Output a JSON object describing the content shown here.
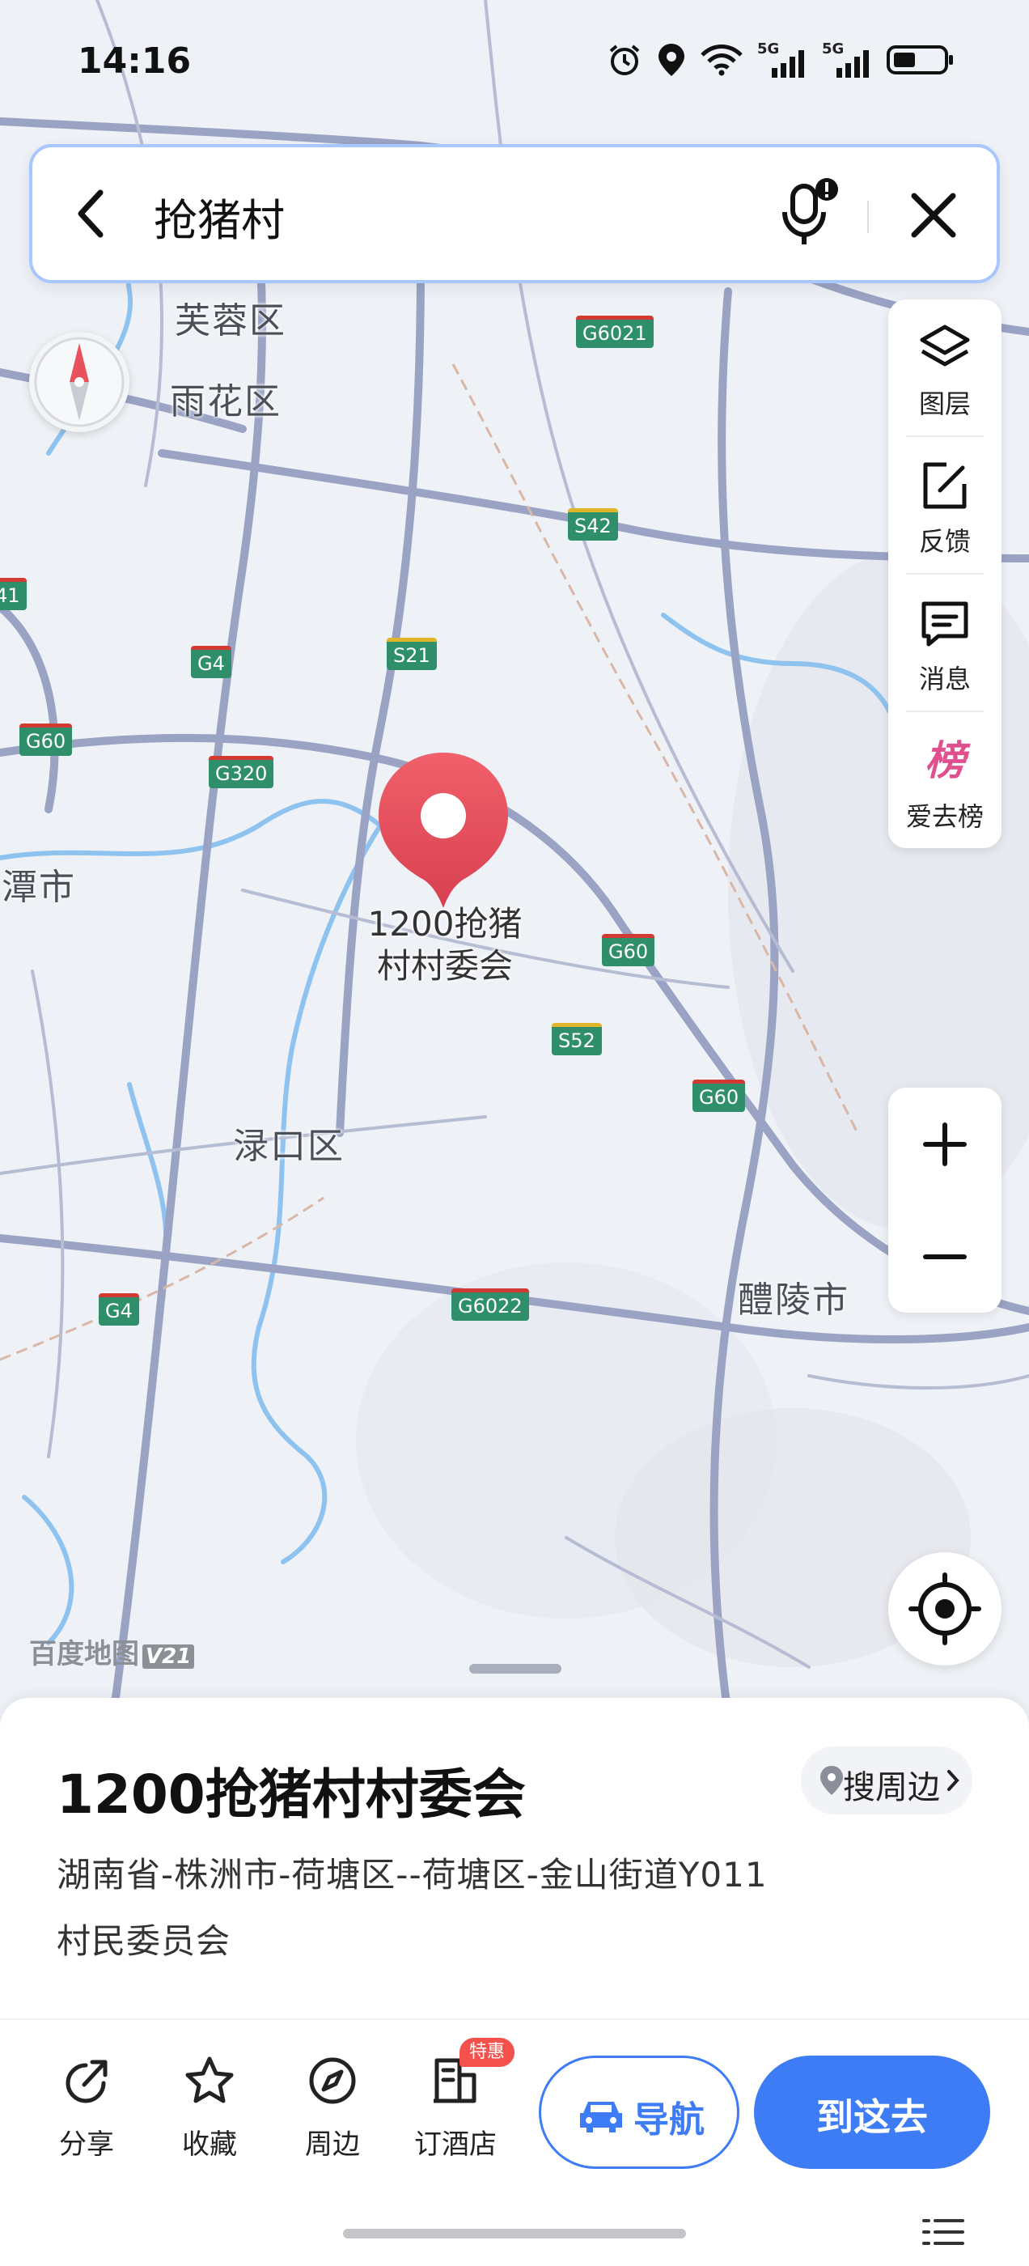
{
  "status_bar": {
    "time": "14:16",
    "network_1": "5G",
    "network_2": "5G"
  },
  "search": {
    "query": "抢猪村"
  },
  "toolbar": {
    "items": [
      {
        "label": "图层",
        "icon": "layers-icon"
      },
      {
        "label": "反馈",
        "icon": "feedback-edit-icon"
      },
      {
        "label": "消息",
        "icon": "message-icon"
      },
      {
        "label": "爱去榜",
        "icon": "ranking-badge-icon",
        "glyph": "榜"
      }
    ]
  },
  "zoom": {
    "in": "+",
    "out": "−"
  },
  "map": {
    "places": [
      "芙蓉区",
      "雨花区",
      "湘潭市",
      "渌口区",
      "醴陵市"
    ],
    "roads": [
      "G6021",
      "S42",
      "S21",
      "G4",
      "G60",
      "G320",
      "G60",
      "S52",
      "G60",
      "G4",
      "G6022",
      "41"
    ],
    "pin_label_line1": "1200抢猪",
    "pin_label_line2": "村村委会",
    "watermark": "百度地图",
    "watermark_version": "V21",
    "pin_color": "#e8505b",
    "road_color": "#9aa3c4"
  },
  "place": {
    "title": "1200抢猪村村委会",
    "nearby_label": "搜周边",
    "address_line1": "湖南省-株洲市-荷塘区--荷塘区-金山街道Y011",
    "address_line2": "村民委员会"
  },
  "actions": [
    {
      "label": "分享",
      "icon": "share-icon"
    },
    {
      "label": "收藏",
      "icon": "star-icon"
    },
    {
      "label": "周边",
      "icon": "compass-icon"
    },
    {
      "label": "订酒店",
      "icon": "hotel-icon",
      "badge": "特惠"
    }
  ],
  "buttons": {
    "navigate": "导航",
    "go_here": "到这去"
  },
  "colors": {
    "accent": "#3d7cf5",
    "badge": "#f4514c"
  }
}
